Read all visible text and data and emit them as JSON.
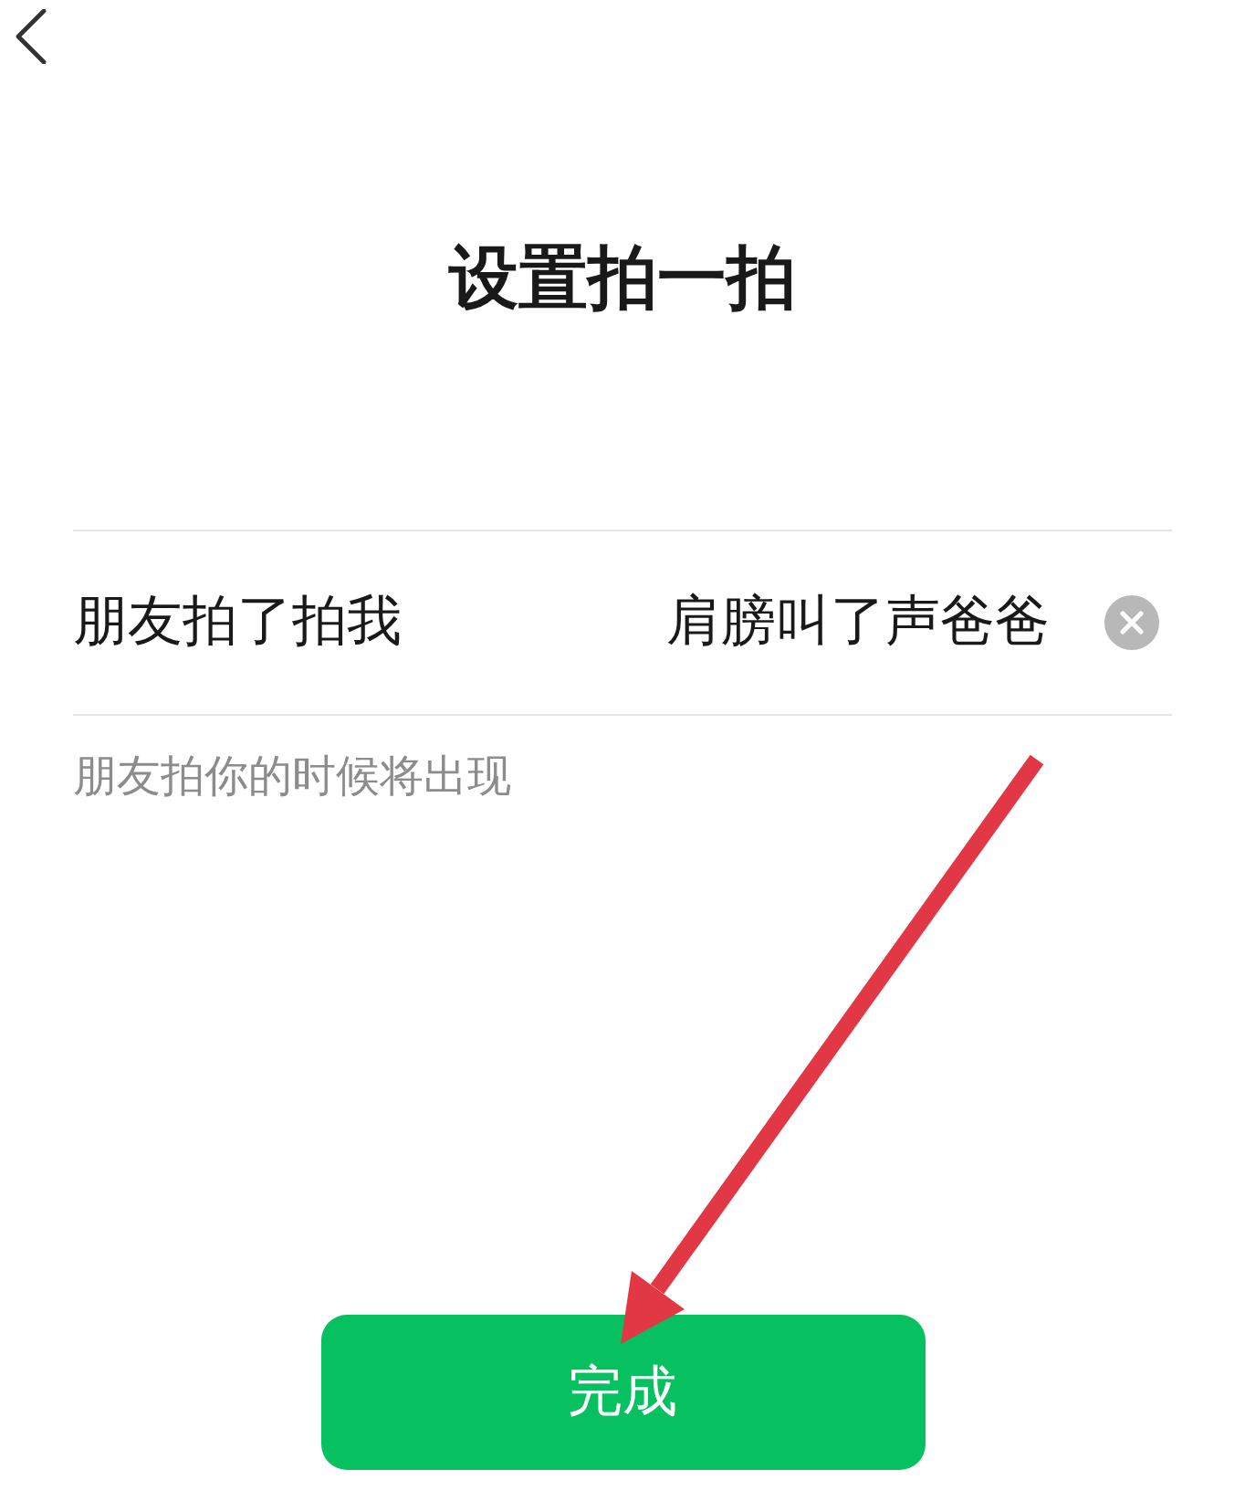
{
  "title": "设置拍一拍",
  "field": {
    "label": "朋友拍了拍我",
    "value": "肩膀叫了声爸爸"
  },
  "hint": "朋友拍你的时候将出现",
  "button": "完成"
}
